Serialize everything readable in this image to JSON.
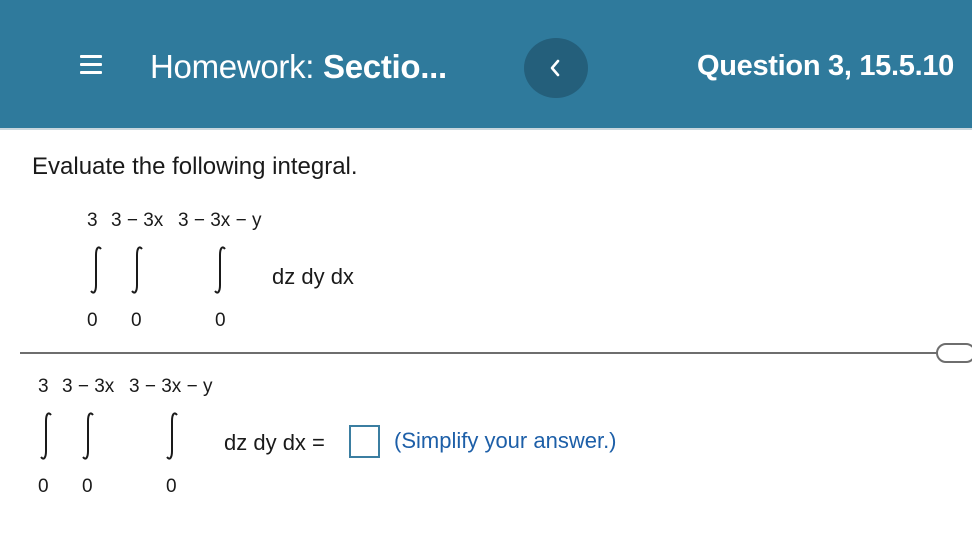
{
  "header": {
    "menu_icon": "hamburger-menu-icon",
    "title_prefix": "Homework:",
    "title_bold": "Sectio...",
    "back_icon": "chevron-left-icon",
    "question_label": "Question 3, 15.5.10",
    "background_color": "#2f7a9c"
  },
  "question": {
    "prompt": "Evaluate the following integral.",
    "outer_upper": "3",
    "middle_upper": "3 − 3x",
    "inner_upper": "3 − 3x − y",
    "outer_lower": "0",
    "middle_lower": "0",
    "inner_lower": "0",
    "differentials": "dz dy dx"
  },
  "answer": {
    "outer_upper": "3",
    "middle_upper": "3 − 3x",
    "inner_upper": "3 − 3x − y",
    "outer_lower": "0",
    "middle_lower": "0",
    "inner_lower": "0",
    "differentials_equals": "dz dy dx =",
    "input_value": "",
    "hint": "(Simplify your answer.)",
    "hint_color": "#1d5fa8"
  }
}
